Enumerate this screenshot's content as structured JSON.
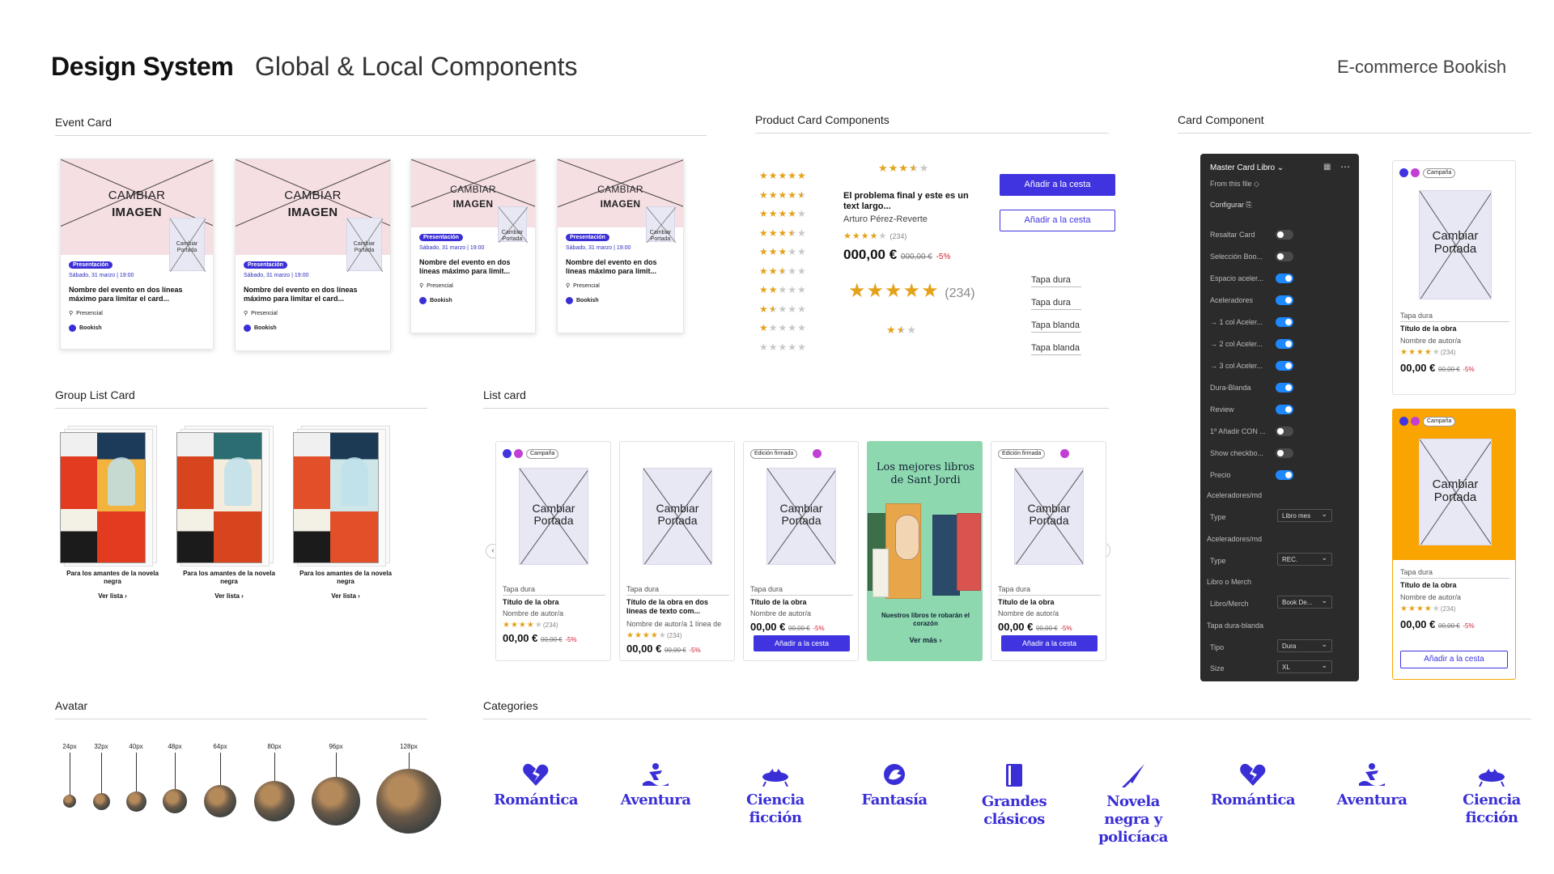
{
  "header": {
    "title": "Design System",
    "subtitle": "Global & Local Components",
    "brand": "E-commerce Bookish"
  },
  "sections": {
    "event_card": "Event Card",
    "product_card": "Product Card Components",
    "card_component": "Card Component",
    "group_list": "Group List Card",
    "list_card": "List card",
    "avatar": "Avatar",
    "categories": "Categories"
  },
  "event_cards": [
    {
      "image_line1": "CAMBIAR",
      "image_line2": "IMAGEN",
      "cover": "Cambiar Portada",
      "badge": "Presentación",
      "date": "Sábado, 31 marzo | 19:00",
      "name": "Nombre del evento en dos líneas máximo para limitar el card...",
      "mode": "Presencial",
      "org": "Bookish"
    },
    {
      "image_line1": "CAMBIAR",
      "image_line2": "IMAGEN",
      "cover": "Cambiar Portada",
      "badge": "Presentación",
      "date": "Sábado, 31 marzo | 19:00",
      "name": "Nombre del evento en dos líneas máximo para limitar el card...",
      "mode": "Presencial",
      "org": "Bookish"
    },
    {
      "image_line1": "CAMBIAR",
      "image_line2": "IMAGEN",
      "cover": "Cambiar Portada",
      "badge": "Presentación",
      "date": "Sábado, 31 marzo | 19:00",
      "name": "Nombre del evento en dos líneas  máximo para limit...",
      "mode": "Presencial",
      "org": "Bookish"
    },
    {
      "image_line1": "CAMBIAR",
      "image_line2": "IMAGEN",
      "cover": "Cambiar Portada",
      "badge": "Presentación",
      "date": "Sábado, 31 marzo | 19:00",
      "name": "Nombre del evento en dos líneas  máximo para limit...",
      "mode": "Presencial",
      "org": "Bookish"
    }
  ],
  "product": {
    "star_rows": [
      "★★★★★",
      "★★★★½",
      "★★★★☆",
      "★★★½☆",
      "★★★☆☆",
      "★★½☆☆",
      "★★☆☆☆",
      "★½☆☆☆",
      "★☆☆☆☆",
      "☆☆☆☆☆"
    ],
    "top_stars": "★★★½☆",
    "book_title": "El problema final y este es un text largo...",
    "book_author": "Arturo Pérez-Reverte",
    "small_stars": "★★★★☆",
    "small_count": "(234)",
    "price": "000,00 €",
    "old_price": "000,00 €",
    "discount": "-5%",
    "big_stars": "★★★★★",
    "big_count": "(234)",
    "half_stars": "★½☆",
    "btn_solid": "Añadir a la cesta",
    "btn_outline": "Añadir a la cesta",
    "formats": [
      "Tapa dura",
      "Tapa dura",
      "Tapa blanda",
      "Tapa blanda"
    ]
  },
  "panel": {
    "title": "Master Card Libro",
    "from": "From this file",
    "configure": "Configurar",
    "toggles": [
      {
        "label": "Resaltar Card",
        "on": false
      },
      {
        "label": "Selección Boo...",
        "on": false
      },
      {
        "label": "Espacio aceler...",
        "on": true
      },
      {
        "label": "Aceleradores",
        "on": true
      },
      {
        "label": "→ 1 col Aceler...",
        "on": true
      },
      {
        "label": "→ 2 col Aceler...",
        "on": true
      },
      {
        "label": "→ 3 col Aceler...",
        "on": true
      },
      {
        "label": "Dura-Blanda",
        "on": true
      },
      {
        "label": "Review",
        "on": true
      },
      {
        "label": "1º Añadir CON ...",
        "on": false
      },
      {
        "label": "Show checkbo...",
        "on": false
      },
      {
        "label": "Precio",
        "on": true
      }
    ],
    "groups": [
      {
        "name": "Aceleradores/md",
        "field": "Type",
        "value": "Libro mes"
      },
      {
        "name": "Aceleradores/md",
        "field": "Type",
        "value": "REC."
      },
      {
        "name": "Libro o Merch",
        "field": "Libro/Merch",
        "value": "Book De..."
      },
      {
        "name": "Tapa dura-blanda",
        "field": "Tipo",
        "value": "Dura"
      }
    ],
    "size_field": "Size",
    "size_value": "XL"
  },
  "card_component": [
    {
      "tag": "Campaña",
      "cover": "Cambiar Portada",
      "format": "Tapa dura",
      "title": "Título de la obra",
      "author": "Nombre de autor/a",
      "stars": "★★★★☆",
      "count": "(234)",
      "price": "00,00 €",
      "old": "00,00 €",
      "disc": "-5%"
    },
    {
      "tag": "Campaña",
      "cover": "Cambiar Portada",
      "format": "Tapa dura",
      "title": "Título de la obra",
      "author": "Nombre de autor/a",
      "stars": "★★★★☆",
      "count": "(234)",
      "price": "00,00 €",
      "old": "00,00 €",
      "disc": "-5%",
      "button": "Añadir a la cesta"
    }
  ],
  "group_list": [
    {
      "caption": "Para los amantes de la novela negra",
      "link": "Ver lista ›"
    },
    {
      "caption": "Para los amantes de la novela negra",
      "link": "Ver lista ›"
    },
    {
      "caption": "Para los amantes de la novela negra",
      "link": "Ver lista ›"
    }
  ],
  "list_cards": [
    {
      "tag": "Campaña",
      "cover": "Cambiar Portada",
      "format": "Tapa dura",
      "title": "Título de la obra",
      "author": "Nombre de autor/a",
      "stars": "★★★★☆",
      "count": "(234)",
      "price": "00,00 €",
      "old": "00,00 €",
      "disc": "-5%"
    },
    {
      "tag": "",
      "cover": "Cambiar Portada",
      "format": "Tapa dura",
      "title": "Título de la obra en dos líneas de texto com...",
      "author": "Nombre de autor/a 1 línea de",
      "stars": "★★★★☆",
      "count": "(234)",
      "price": "00,00 €",
      "old": "00,00 €",
      "disc": "-5%"
    },
    {
      "tag": "Edición firmada",
      "cover": "Cambiar Portada",
      "format": "Tapa dura",
      "title": "Título de la obra",
      "author": "Nombre de autor/a",
      "stars": "",
      "count": "",
      "price": "00,00 €",
      "old": "00,00 €",
      "disc": "-5%",
      "button": "Añadir a la cesta"
    },
    {
      "promo_title": "Los mejores libros de Sant Jordi",
      "promo_text": "Nuestros libros te robarán el corazón",
      "promo_link": "Ver más ›"
    },
    {
      "tag": "Edición firmada",
      "cover": "Cambiar Portada",
      "format": "Tapa dura",
      "title": "Título de la obra",
      "author": "Nombre de autor/a",
      "stars": "",
      "count": "",
      "price": "00,00 €",
      "old": "00,00 €",
      "disc": "-5%",
      "button": "Añadir a la cesta"
    }
  ],
  "avatars": [
    "24px",
    "32px",
    "40px",
    "48px",
    "64px",
    "80px",
    "96px",
    "128px"
  ],
  "categories": [
    {
      "label": "Romántica",
      "icon": "broken-heart-icon"
    },
    {
      "label": "Aventura",
      "icon": "surfer-icon"
    },
    {
      "label": "Ciencia ficción",
      "icon": "alien-ship-icon"
    },
    {
      "label": "Fantasía",
      "icon": "dragon-icon"
    },
    {
      "label": "Grandes clásicos",
      "icon": "book-icon"
    },
    {
      "label": "Novela negra y policíaca",
      "icon": "knife-icon"
    },
    {
      "label": "Romántica",
      "icon": "broken-heart-icon"
    },
    {
      "label": "Aventura",
      "icon": "surfer-icon"
    },
    {
      "label": "Ciencia ficción",
      "icon": "alien-ship-icon"
    }
  ],
  "colors": {
    "accent": "#3f34e0",
    "pink": "#f6dfe3",
    "panel": "#2b2b2b",
    "orange": "#f9a400",
    "promo": "#8ed8b0",
    "price_red": "#d0223a",
    "star": "#e3a21a"
  }
}
